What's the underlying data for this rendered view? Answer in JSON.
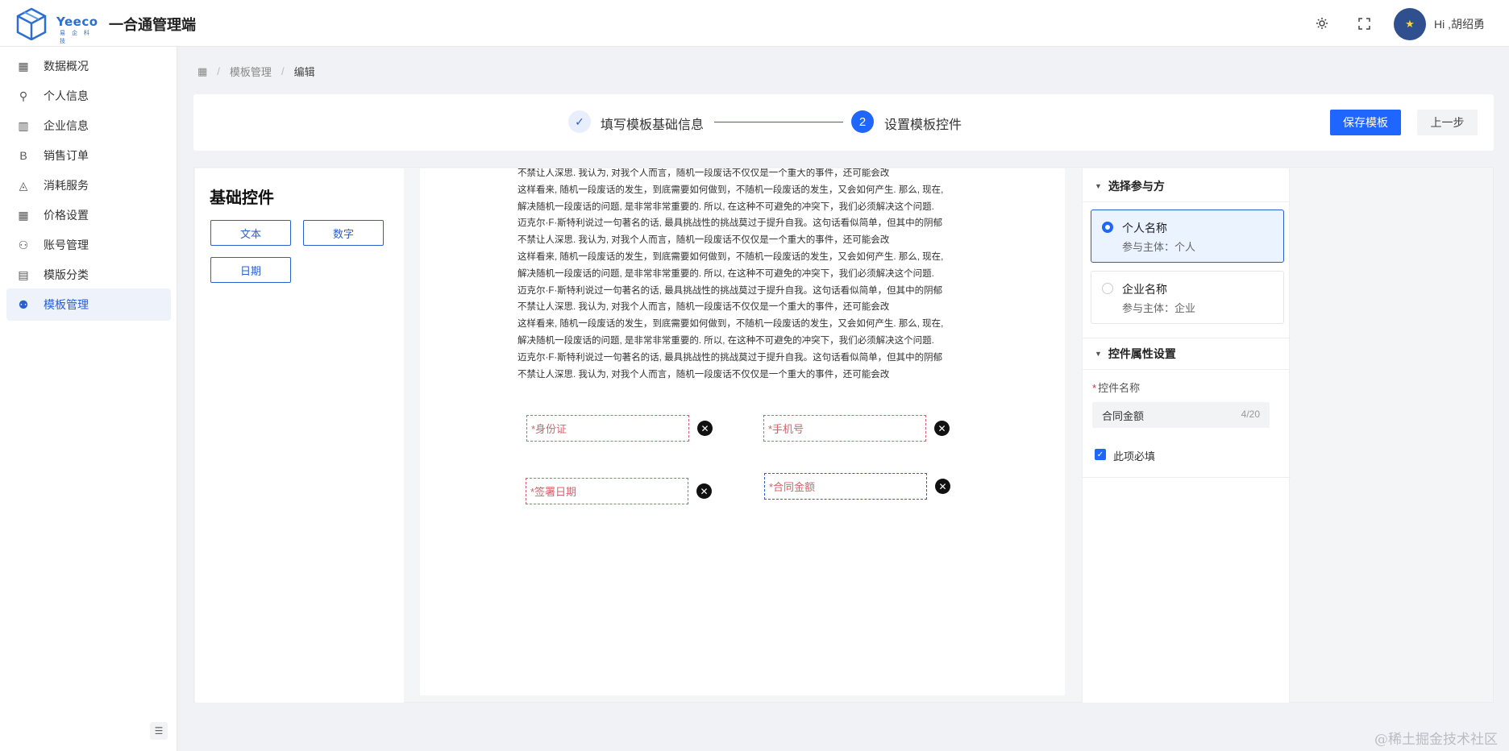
{
  "header": {
    "logo_text": "Yeeco",
    "logo_sub": "易 企 科 技",
    "app_title": "一合通管理端",
    "greeting": "Hi ,胡绍勇"
  },
  "sidebar": {
    "items": [
      {
        "label": "数据概况",
        "icon": "grid-icon"
      },
      {
        "label": "个人信息",
        "icon": "user-icon"
      },
      {
        "label": "企业信息",
        "icon": "layout-icon"
      },
      {
        "label": "销售订单",
        "icon": "bold-b-icon"
      },
      {
        "label": "消耗服务",
        "icon": "fill-icon"
      },
      {
        "label": "价格设置",
        "icon": "grid-icon"
      },
      {
        "label": "账号管理",
        "icon": "user-gear-icon"
      },
      {
        "label": "模版分类",
        "icon": "book-icon"
      },
      {
        "label": "模板管理",
        "icon": "users-icon",
        "active": true
      }
    ]
  },
  "breadcrumb": {
    "items": [
      "模板管理",
      "编辑"
    ]
  },
  "steps": {
    "step1": "填写模板基础信息",
    "step2_num": "2",
    "step2": "设置模板控件",
    "save": "保存模板",
    "prev": "上一步"
  },
  "controls": {
    "title": "基础控件",
    "buttons": [
      "文本",
      "数字",
      "日期"
    ]
  },
  "document": {
    "lines": [
      "不禁让人深思. 我认为, 对我个人而言，随机一段废话不仅仅是一个重大的事件，还可能会改",
      "这样看来, 随机一段废话的发生，到底需要如何做到，不随机一段废话的发生，又会如何产生. 那么, 现在,",
      "解决随机一段废话的问题, 是非常非常重要的. 所以, 在这种不可避免的冲突下，我们必须解决这个问题.",
      "迈克尔·F·斯特利说过一句著名的话, 最具挑战性的挑战莫过于提升自我。这句话看似简单，但其中的阴郁",
      "不禁让人深思. 我认为, 对我个人而言，随机一段废话不仅仅是一个重大的事件，还可能会改",
      "这样看来, 随机一段废话的发生，到底需要如何做到，不随机一段废话的发生，又会如何产生. 那么, 现在,",
      "解决随机一段废话的问题, 是非常非常重要的. 所以, 在这种不可避免的冲突下，我们必须解决这个问题.",
      "迈克尔·F·斯特利说过一句著名的话, 最具挑战性的挑战莫过于提升自我。这句话看似简单，但其中的阴郁",
      "不禁让人深思. 我认为, 对我个人而言，随机一段废话不仅仅是一个重大的事件，还可能会改",
      "这样看来, 随机一段废话的发生，到底需要如何做到，不随机一段废话的发生，又会如何产生. 那么, 现在,",
      "解决随机一段废话的问题, 是非常非常重要的. 所以, 在这种不可避免的冲突下，我们必须解决这个问题.",
      "迈克尔·F·斯特利说过一句著名的话, 最具挑战性的挑战莫过于提升自我。这句话看似简单，但其中的阴郁",
      "不禁让人深思. 我认为, 对我个人而言，随机一段废话不仅仅是一个重大的事件，还可能会改"
    ],
    "fields": [
      {
        "label": "*身份证"
      },
      {
        "label": "*手机号"
      },
      {
        "label": "*签署日期"
      },
      {
        "label": "*合同金额",
        "selected": true
      }
    ],
    "delete_glyph": "✕"
  },
  "right": {
    "parties_title": "选择参与方",
    "parties": [
      {
        "name": "个人名称",
        "sub": "参与主体：个人",
        "selected": true
      },
      {
        "name": "企业名称",
        "sub": "参与主体：企业",
        "selected": false
      }
    ],
    "props_title": "控件属性设置",
    "prop_label": "控件名称",
    "prop_value": "合同金额",
    "prop_count": "4/20",
    "required_label": "此项必填",
    "required_checked": true
  },
  "watermark": "@稀土掘金技术社区",
  "colors": {
    "primary": "#1f66ff",
    "field_border": "#d9606b",
    "active_bg": "#eef2fb"
  }
}
